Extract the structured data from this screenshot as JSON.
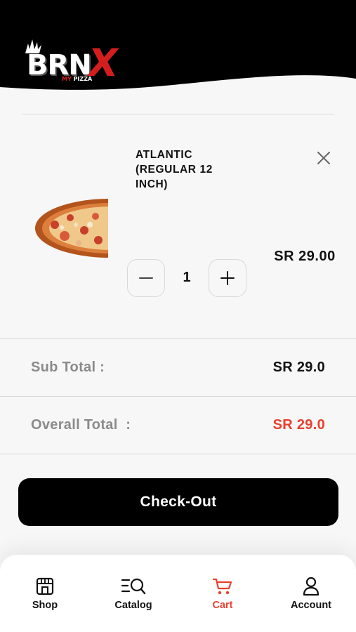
{
  "header": {
    "logo_text": "BRN",
    "logo_x": "X",
    "logo_sub_my": "MY",
    "logo_sub_pizza": "PIZZA"
  },
  "cart": {
    "item": {
      "name": "ATLANTIC (REGULAR 12 INCH)",
      "quantity": "1",
      "price": "SR 29.00",
      "image_icon": "pizza-image",
      "remove_icon": "close-icon",
      "minus_icon": "minus-icon",
      "plus_icon": "plus-icon"
    }
  },
  "totals": {
    "subtotal_label": "Sub Total :",
    "subtotal_value": "SR 29.0",
    "overall_label": "Overall Total  :",
    "overall_value": "SR 29.0"
  },
  "checkout": {
    "label": "Check-Out"
  },
  "nav": {
    "items": [
      {
        "label": "Shop",
        "icon": "shop-icon",
        "active": false
      },
      {
        "label": "Catalog",
        "icon": "catalog-search-icon",
        "active": false
      },
      {
        "label": "Cart",
        "icon": "cart-icon",
        "active": true
      },
      {
        "label": "Account",
        "icon": "user-icon",
        "active": false
      }
    ]
  },
  "colors": {
    "accent": "#e8402e",
    "header_bg": "#000000",
    "checkout_bg": "#000000",
    "page_bg": "#f7f7f7"
  }
}
